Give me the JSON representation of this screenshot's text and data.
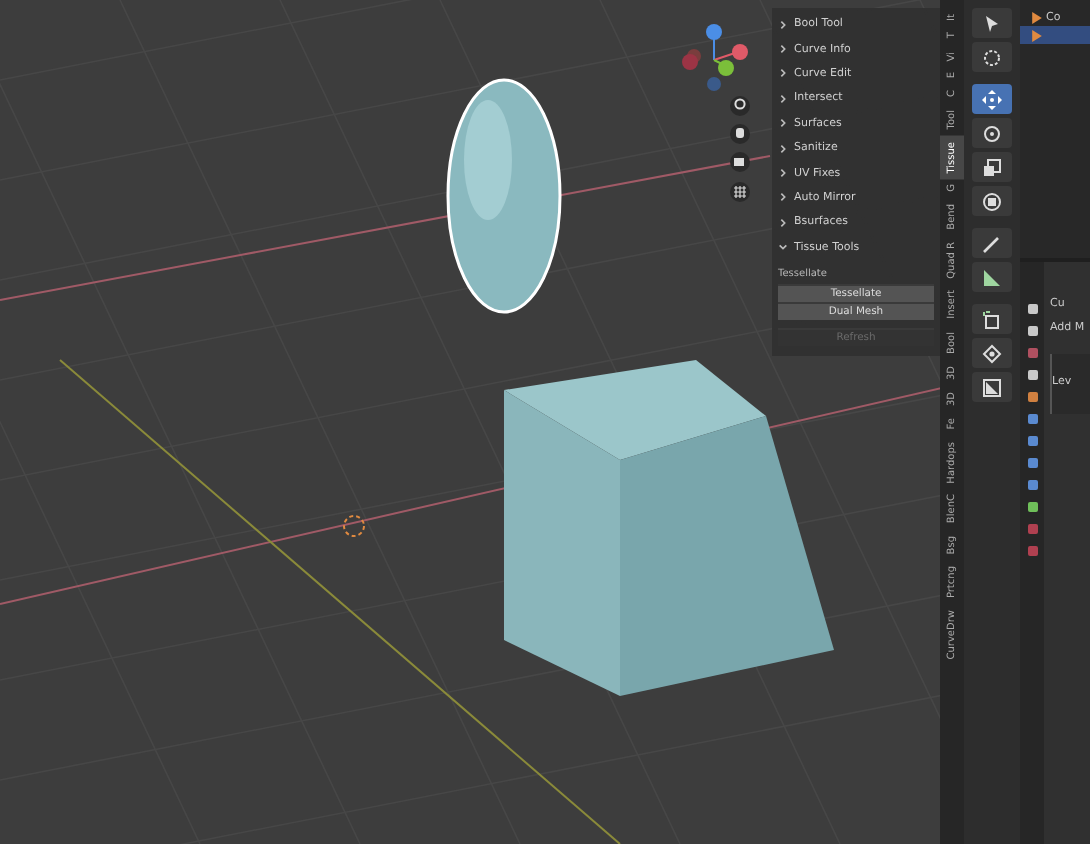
{
  "sidebar_panels": [
    {
      "label": "Bool Tool",
      "expanded": false
    },
    {
      "label": "Curve Info",
      "expanded": false
    },
    {
      "label": "Curve Edit",
      "expanded": false
    },
    {
      "label": "Intersect",
      "expanded": false
    },
    {
      "label": "Surfaces",
      "expanded": false
    },
    {
      "label": "Sanitize",
      "expanded": false
    },
    {
      "label": "UV Fixes",
      "expanded": false
    },
    {
      "label": "Auto Mirror",
      "expanded": false
    },
    {
      "label": "Bsurfaces",
      "expanded": false
    },
    {
      "label": "Tissue Tools",
      "expanded": true
    }
  ],
  "tessellate": {
    "heading": "Tessellate",
    "buttons": [
      {
        "label": "Tessellate",
        "disabled": false
      },
      {
        "label": "Dual Mesh",
        "disabled": false
      },
      {
        "label": "Refresh",
        "disabled": true
      }
    ]
  },
  "sidebar_tabs": [
    {
      "label": "It",
      "selected": false
    },
    {
      "label": "T",
      "selected": false
    },
    {
      "label": "Vi",
      "selected": false
    },
    {
      "label": "E",
      "selected": false
    },
    {
      "label": "C",
      "selected": false
    },
    {
      "label": "Tool",
      "selected": false
    },
    {
      "label": "Tissue",
      "selected": true
    },
    {
      "label": "G",
      "selected": false
    },
    {
      "label": "Bend",
      "selected": false
    },
    {
      "label": "Quad R",
      "selected": false
    },
    {
      "label": "Insert",
      "selected": false
    },
    {
      "label": "Bool",
      "selected": false
    },
    {
      "label": "3D",
      "selected": false
    },
    {
      "label": "3D",
      "selected": false
    },
    {
      "label": "Fe",
      "selected": false
    },
    {
      "label": "Hardops",
      "selected": false
    },
    {
      "label": "BlenC",
      "selected": false
    },
    {
      "label": "Bsg",
      "selected": false
    },
    {
      "label": "Prtcng",
      "selected": false
    },
    {
      "label": "CurveDrw",
      "selected": false
    }
  ],
  "toolbar": [
    {
      "kind": "select",
      "selected": false
    },
    {
      "kind": "cursor",
      "selected": false
    },
    {
      "kind": "move",
      "selected": true
    },
    {
      "kind": "rotate",
      "selected": false
    },
    {
      "kind": "scale",
      "selected": false
    },
    {
      "kind": "transform",
      "selected": false
    },
    {
      "kind": "annotate",
      "selected": false
    },
    {
      "kind": "measure",
      "selected": false
    },
    {
      "kind": "cube",
      "selected": false
    },
    {
      "kind": "shrink",
      "selected": false
    },
    {
      "kind": "box",
      "selected": false
    }
  ],
  "outliner": {
    "rows": [
      {
        "label": "Co",
        "selected": false
      },
      {
        "label": "",
        "selected": true
      }
    ]
  },
  "properties": {
    "object_name": "Cu",
    "add_modifier": "Add M",
    "level_label": "Lev"
  }
}
